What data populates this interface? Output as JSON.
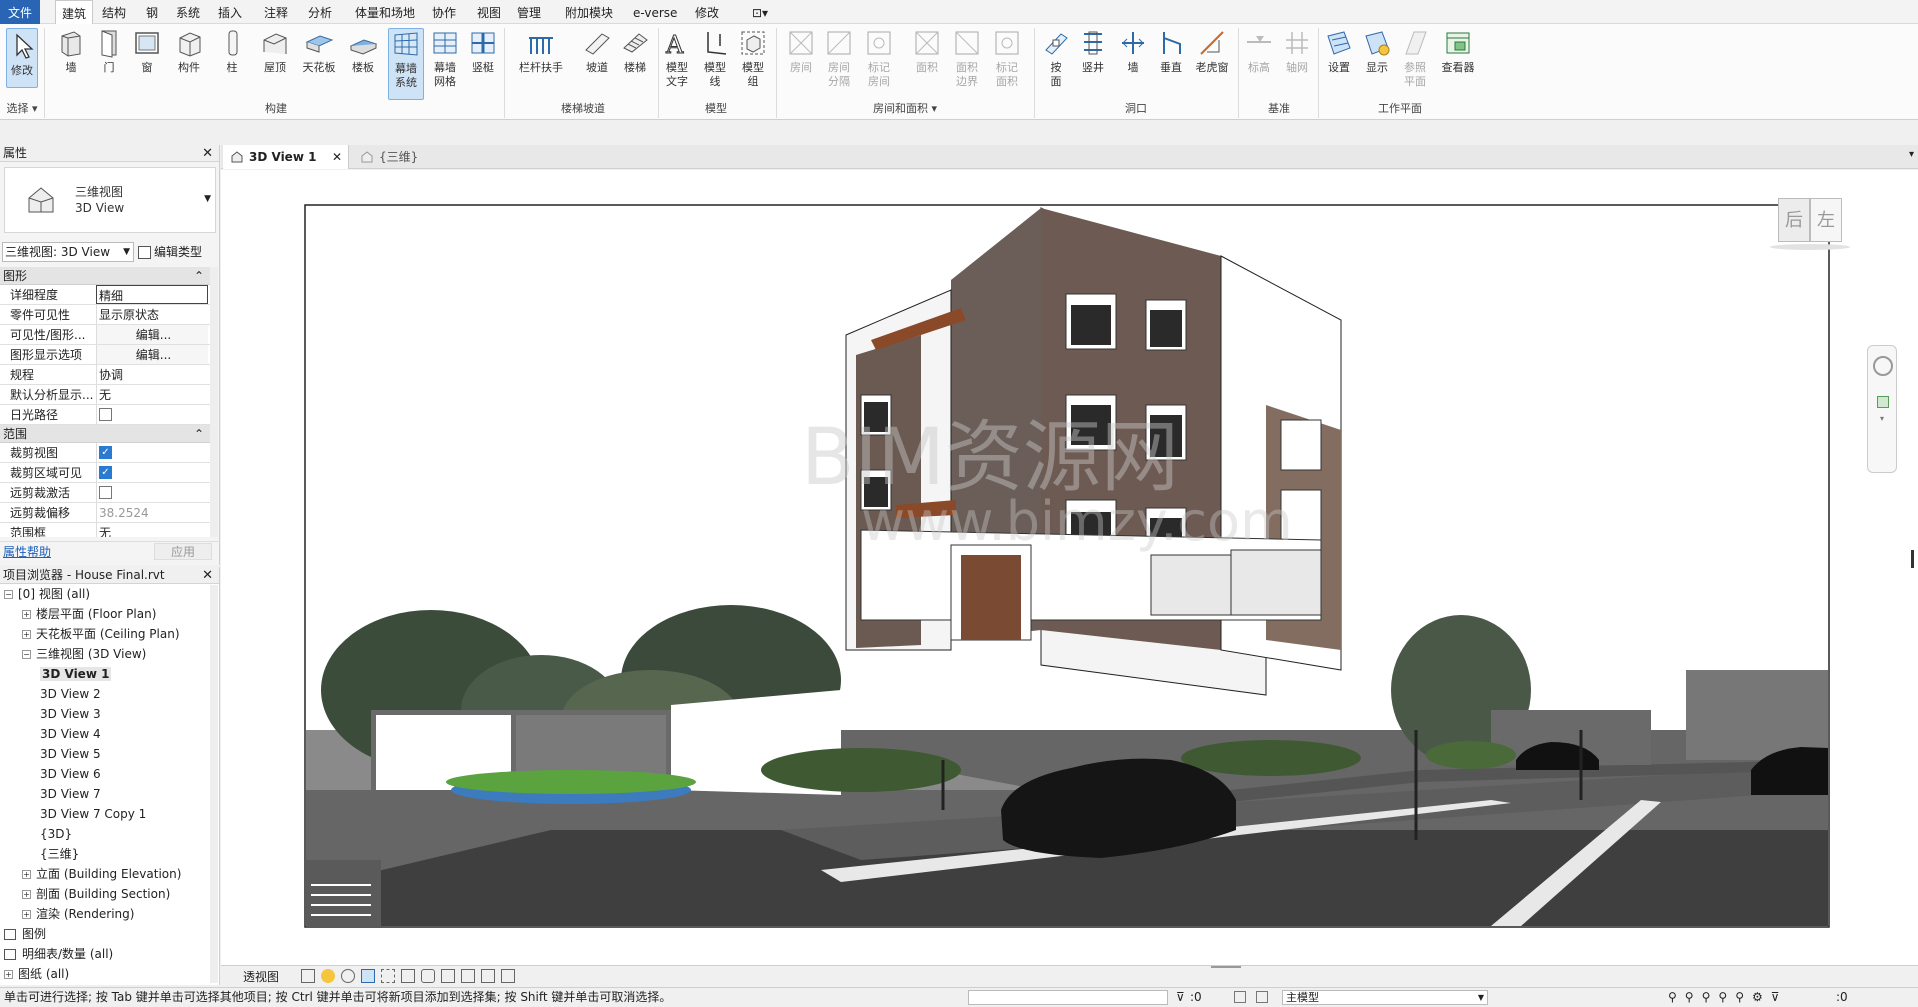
{
  "menubar": {
    "items": [
      "文件",
      "建筑",
      "结构",
      "钢",
      "系统",
      "插入",
      "注释",
      "分析",
      "体量和场地",
      "协作",
      "视图",
      "管理",
      "附加模块",
      "e-verse",
      "修改"
    ]
  },
  "ribbon": {
    "select": {
      "modify": "修改",
      "select": "选择"
    },
    "build": {
      "wall": "墙",
      "door": "门",
      "window": "窗",
      "component": "构件",
      "column": "柱",
      "roof": "屋顶",
      "ceiling": "天花板",
      "floor": "楼板",
      "curtain_system": "幕墙\n系统",
      "curtain_grid": "幕墙\n网格",
      "mullion": "竖梃",
      "group": "构建"
    },
    "stairs": {
      "railing": "栏杆扶手",
      "ramp": "坡道",
      "stair": "楼梯",
      "group": "楼梯坡道"
    },
    "model": {
      "text": "模型\n文字",
      "line": "模型\n线",
      "group_btn": "模型\n组",
      "group": "模型"
    },
    "room": {
      "room": "房间",
      "separator": "房间\n分隔",
      "tag_room": "标记\n房间",
      "area": "面积",
      "area_boundary": "面积\n边界",
      "tag_area": "标记\n面积",
      "group": "房间和面积"
    },
    "opening": {
      "by_face": "按\n面",
      "shaft": "竖井",
      "wall": "墙",
      "vertical": "垂直",
      "dormer": "老虎窗",
      "group": "洞口"
    },
    "datum": {
      "level": "标高",
      "grid": "轴网",
      "group": "基准"
    },
    "workplane": {
      "set": "设置",
      "show": "显示",
      "ref_plane": "参照\n平面",
      "viewer": "查看器",
      "group": "工作平面"
    }
  },
  "properties": {
    "title": "属性",
    "type_name_cn": "三维视图",
    "type_name_en": "3D View",
    "instance_selector": "三维视图: 3D View",
    "edit_type": "编辑类型",
    "sections": [
      {
        "name": "图形"
      },
      {
        "name": "范围"
      }
    ],
    "rows": [
      {
        "k": "详细程度",
        "v": "精细"
      },
      {
        "k": "零件可见性",
        "v": "显示原状态"
      },
      {
        "k": "可见性/图形...",
        "v": "编辑..."
      },
      {
        "k": "图形显示选项",
        "v": "编辑..."
      },
      {
        "k": "规程",
        "v": "协调"
      },
      {
        "k": "默认分析显示...",
        "v": "无"
      },
      {
        "k": "日光路径",
        "v": ""
      },
      {
        "k": "裁剪视图",
        "v": ""
      },
      {
        "k": "裁剪区域可见",
        "v": ""
      },
      {
        "k": "远剪裁激活",
        "v": ""
      },
      {
        "k": "远剪裁偏移",
        "v": "38.2524"
      },
      {
        "k": "范围框",
        "v": "无"
      }
    ],
    "help": "属性帮助",
    "apply": "应用"
  },
  "browser": {
    "title": "项目浏览器 - House Final.rvt",
    "items": [
      {
        "label": "[0] 视图 (all)",
        "indent": 0,
        "exp": "−"
      },
      {
        "label": "楼层平面 (Floor Plan)",
        "indent": 1,
        "exp": "+"
      },
      {
        "label": "天花板平面 (Ceiling Plan)",
        "indent": 1,
        "exp": "+"
      },
      {
        "label": "三维视图 (3D View)",
        "indent": 1,
        "exp": "−"
      },
      {
        "label": "3D View 1",
        "indent": 2,
        "exp": "",
        "bold": true
      },
      {
        "label": "3D View 2",
        "indent": 2,
        "exp": ""
      },
      {
        "label": "3D View 3",
        "indent": 2,
        "exp": ""
      },
      {
        "label": "3D View 4",
        "indent": 2,
        "exp": ""
      },
      {
        "label": "3D View 5",
        "indent": 2,
        "exp": ""
      },
      {
        "label": "3D View 6",
        "indent": 2,
        "exp": ""
      },
      {
        "label": "3D View 7",
        "indent": 2,
        "exp": ""
      },
      {
        "label": "3D View 7 Copy 1",
        "indent": 2,
        "exp": ""
      },
      {
        "label": "{3D}",
        "indent": 2,
        "exp": ""
      },
      {
        "label": "{三维}",
        "indent": 2,
        "exp": ""
      },
      {
        "label": "立面 (Building Elevation)",
        "indent": 1,
        "exp": "+"
      },
      {
        "label": "剖面 (Building Section)",
        "indent": 1,
        "exp": "+"
      },
      {
        "label": "渲染 (Rendering)",
        "indent": 1,
        "exp": "+"
      },
      {
        "label": "图例",
        "indent": 0,
        "exp": ""
      },
      {
        "label": "明细表/数量 (all)",
        "indent": 0,
        "exp": ""
      },
      {
        "label": "图纸 (all)",
        "indent": 0,
        "exp": "+"
      }
    ]
  },
  "viewtabs": [
    {
      "label": "3D View 1",
      "active": true
    },
    {
      "label": "{三维}",
      "active": false
    }
  ],
  "viewcube": {
    "back": "后",
    "left": "左"
  },
  "watermark": {
    "line1": "BIM资源网",
    "line2": "www.bimzy.com"
  },
  "viewctl": {
    "mode": "透视图"
  },
  "status": {
    "text": "单击可进行选择; 按 Tab 键并单击可选择其他项目; 按 Ctrl 键并单击可将新项目添加到选择集; 按 Shift 键并单击可取消选择。",
    "count1": ":0",
    "model": "主模型",
    "count2": ":0"
  }
}
